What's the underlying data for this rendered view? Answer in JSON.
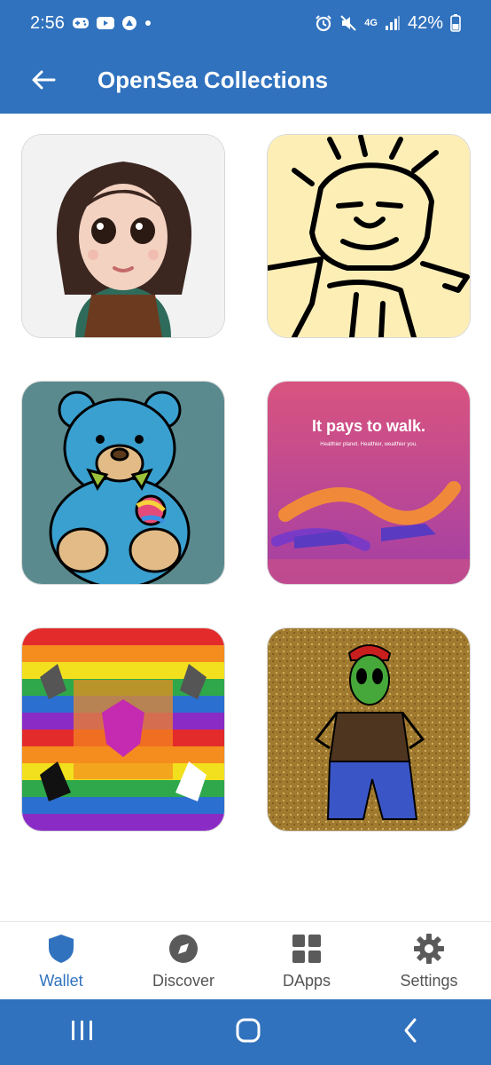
{
  "status_bar": {
    "time": "2:56",
    "network": "4G",
    "battery": "42%"
  },
  "app_bar": {
    "title": "OpenSea Collections",
    "back_icon": "arrow-left-icon"
  },
  "collections": [
    {
      "subject": "cartoon-girl-portrait"
    },
    {
      "subject": "sketch-face-drawing"
    },
    {
      "subject": "blue-teddy-bear"
    },
    {
      "subject": "sneakers-ad",
      "headline": "It pays to walk.",
      "tagline": "Healthier planet. Healthier, wealthier you."
    },
    {
      "subject": "rainbow-eagle-crest"
    },
    {
      "subject": "green-alien-glitter"
    }
  ],
  "bottom_nav": [
    {
      "label": "Wallet",
      "icon": "shield-icon",
      "active": true
    },
    {
      "label": "Discover",
      "icon": "compass-icon",
      "active": false
    },
    {
      "label": "DApps",
      "icon": "grid-icon",
      "active": false
    },
    {
      "label": "Settings",
      "icon": "gear-icon",
      "active": false
    }
  ],
  "colors": {
    "primary": "#3072be",
    "nav_inactive": "#545454",
    "background": "#ffffff"
  }
}
